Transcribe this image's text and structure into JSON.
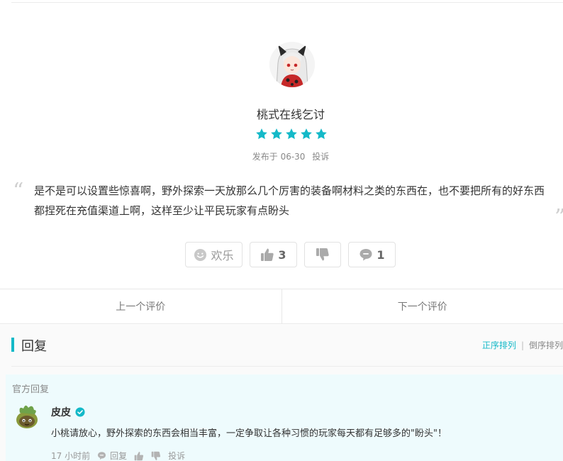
{
  "review": {
    "username": "桃式在线乞讨",
    "rating": 5,
    "date_prefix": "发布于",
    "date": "06-30",
    "report_label": "投诉",
    "text": "是不是可以设置些惊喜啊，野外探索一天放那么几个厉害的装备啊材料之类的东西在，也不要把所有的好东西都捏死在充值渠道上啊，这样至少让平民玩家有点盼头"
  },
  "actions": {
    "fun_label": "欢乐",
    "upvotes": "3",
    "comments": "1"
  },
  "nav": {
    "prev_label": "上一个评价",
    "next_label": "下一个评价"
  },
  "replies": {
    "title": "回复",
    "sort_asc": "正序排列",
    "sort_desc": "倒序排列",
    "official_label": "官方回复",
    "official": {
      "name": "皮皮",
      "text": "小桃请放心，野外探索的东西会相当丰富，一定争取让各种习惯的玩家每天都有足够多的\"盼头\"！",
      "time": "17 小时前",
      "reply_label": "回复",
      "report_label": "投诉"
    }
  },
  "colors": {
    "accent": "#14b9c8",
    "star": "#14b9c8",
    "official_bg": "#eefbfd"
  }
}
